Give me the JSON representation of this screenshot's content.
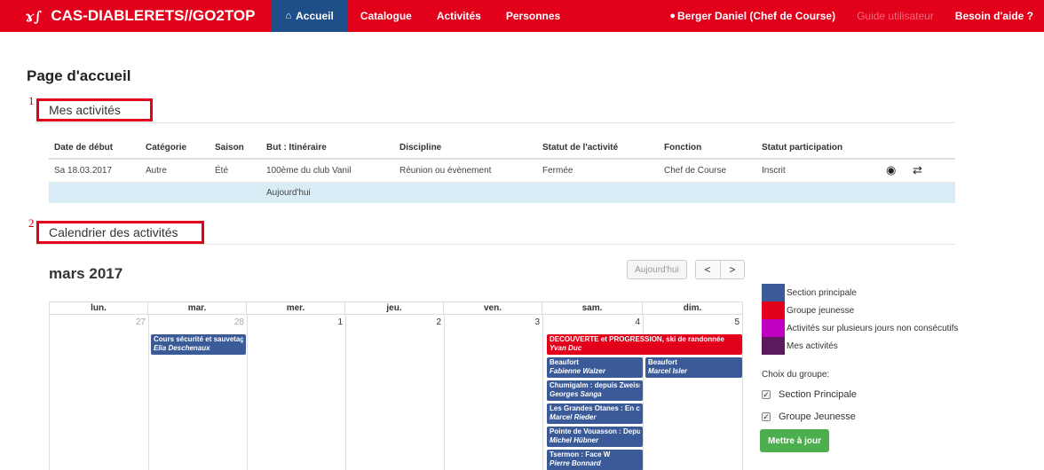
{
  "nav": {
    "brand": "CAS-DIABLERETS//GO2TOP",
    "items": [
      "Accueil",
      "Catalogue",
      "Activités",
      "Personnes"
    ],
    "user": "Berger Daniel (Chef de Course)",
    "guide": "Guide utilisateur",
    "help": "Besoin d'aide ?"
  },
  "page_title": "Page d'accueil",
  "sections": [
    {
      "num": "1",
      "label": "Mes activités"
    },
    {
      "num": "2",
      "label": "Calendrier des activités"
    }
  ],
  "table": {
    "headers": [
      "Date de début",
      "Catégorie",
      "Saison",
      "But : Itinéraire",
      "Discipline",
      "Statut de l'activité",
      "Fonction",
      "Statut participation"
    ],
    "row": [
      "Sa 18.03.2017",
      "Autre",
      "Été",
      "100ème du club Vanil",
      "Réunion ou évènement",
      "Fermée",
      "Chef de Course",
      "Inscrit"
    ],
    "today": "Aujourd'hui"
  },
  "calendar": {
    "title": "mars 2017",
    "today_btn": "Aujourd'hui",
    "prev": "<",
    "next": ">",
    "days": [
      "lun.",
      "mar.",
      "mer.",
      "jeu.",
      "ven.",
      "sam.",
      "dim."
    ],
    "dates": [
      "27",
      "28",
      "1",
      "2",
      "3",
      "4",
      "5"
    ],
    "events": [
      {
        "title": "Cours sécurité et sauvetage",
        "person": "Elia Deschenaux",
        "color": "#3a5a98"
      },
      {
        "title": "DECOUVERTE et PROGRESSION, ski de randonnée",
        "person": "Yvan Duc",
        "color": "#e2001a"
      },
      {
        "title": "Beaufort",
        "person": "Fabienne Walzer",
        "color": "#3a5a98"
      },
      {
        "title": "Beaufort",
        "person": "Marcel Isler",
        "color": "#3a5a98"
      },
      {
        "title": "Chumigalm : depuis Zweissi",
        "person": "Georges Sanga",
        "color": "#3a5a98"
      },
      {
        "title": "Les Grandes Otanes : En circ",
        "person": "Marcel Rieder",
        "color": "#3a5a98"
      },
      {
        "title": "Pointe de Vouasson : Depuis",
        "person": "Michel Hübner",
        "color": "#3a5a98"
      },
      {
        "title": "Tsermon : Face W",
        "person": "Pierre Bonnard",
        "color": "#3a5a98"
      }
    ]
  },
  "legend": [
    {
      "label": "Section principale",
      "color": "#3a5a98"
    },
    {
      "label": "Groupe jeunesse",
      "color": "#e2001a"
    },
    {
      "label": "Activités sur plusieurs jours non consécutifs",
      "color": "#c000c0"
    },
    {
      "label": "Mes activités",
      "color": "#5c1a5c"
    }
  ],
  "group_choice": {
    "title": "Choix du groupe:",
    "options": [
      "Section Principale",
      "Groupe Jeunesse"
    ],
    "button": "Mettre à jour"
  }
}
